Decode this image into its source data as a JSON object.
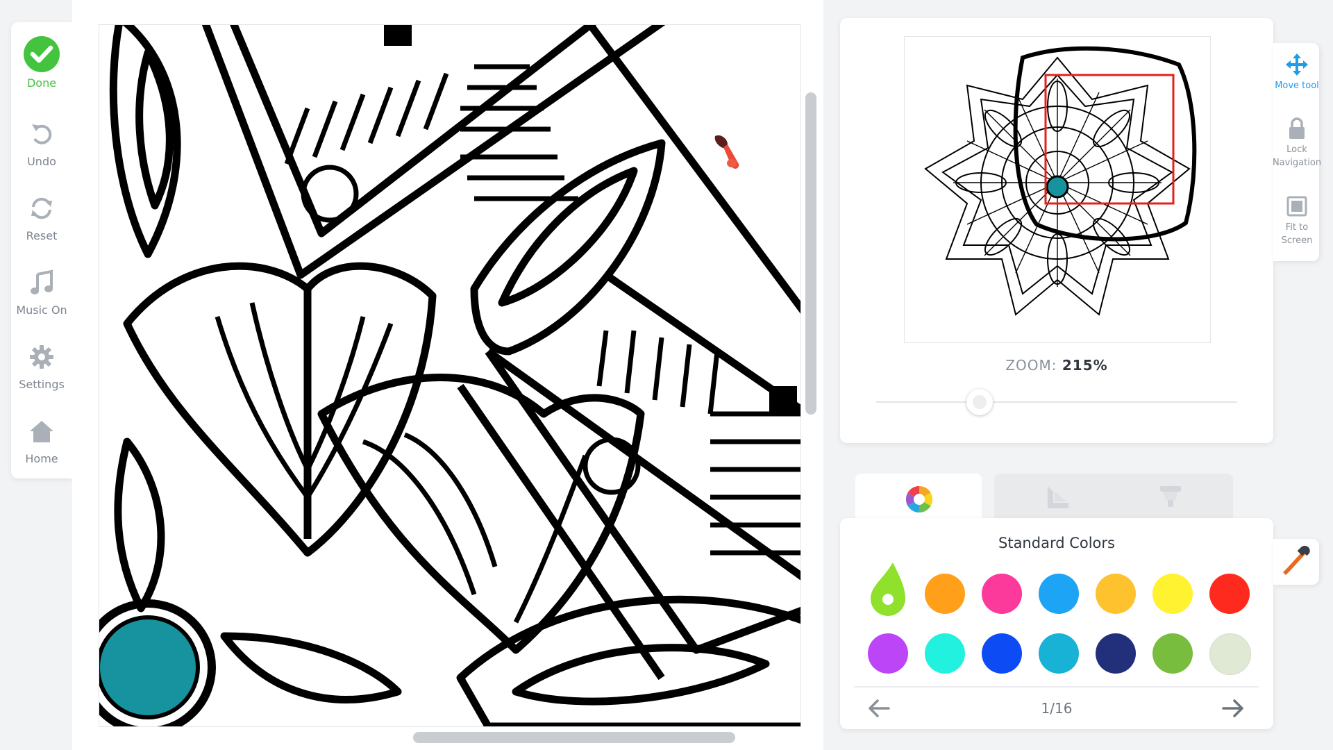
{
  "toolbar": {
    "done_label": "Done",
    "undo_label": "Undo",
    "reset_label": "Reset",
    "music_label": "Music On",
    "settings_label": "Settings",
    "home_label": "Home"
  },
  "navigator": {
    "zoom_label": "ZOOM:",
    "zoom_value": "215%"
  },
  "nav_tools": {
    "move_label": "Move tool",
    "lock_label_1": "Lock",
    "lock_label_2": "Navigation",
    "fit_label_1": "Fit to",
    "fit_label_2": "Screen"
  },
  "tabs": [
    "colors-tab-icon",
    "gradients-tab-icon",
    "textures-tab-icon"
  ],
  "palette": {
    "title": "Standard Colors",
    "page": "1/16",
    "selected_color": "#8fe12b",
    "swatches": [
      "#8fe12b",
      "#ff9f1a",
      "#fb3a9c",
      "#1ea4f4",
      "#fdc22e",
      "#fff230",
      "#ff2a1e",
      "#bc45f7",
      "#23f1e0",
      "#0d4cf4",
      "#17b2d6",
      "#22307b",
      "#79bd3e",
      "#dfe9d3"
    ]
  },
  "colors": {
    "accent_green": "#43c33e",
    "accent_blue": "#1e9ce8",
    "filled_region": "#16939f",
    "viewport_outline": "#e3201b"
  }
}
